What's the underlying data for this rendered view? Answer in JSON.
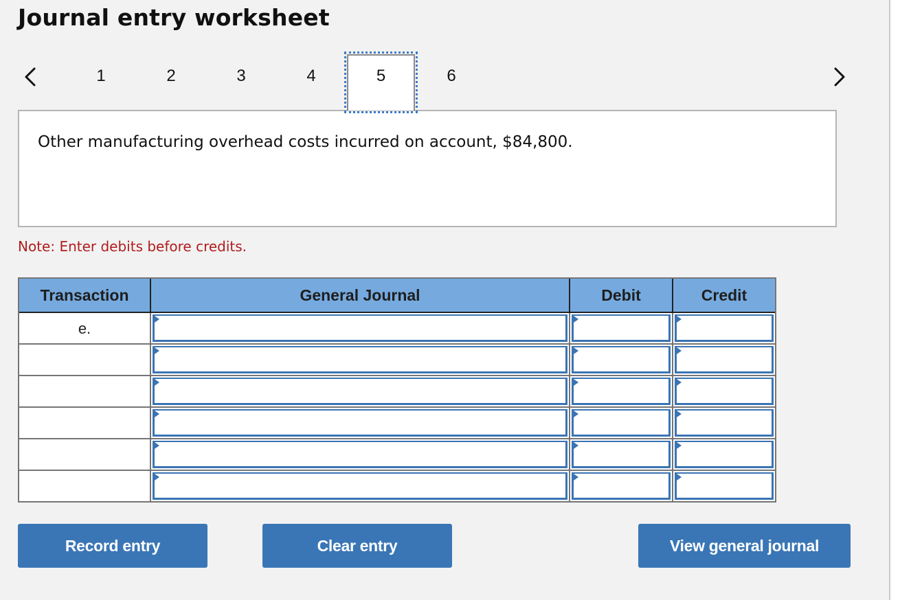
{
  "title": "Journal entry worksheet",
  "navigation": {
    "prev_icon": "chevron-left-icon",
    "next_icon": "chevron-right-icon",
    "steps": [
      "1",
      "2",
      "3",
      "4",
      "5",
      "6"
    ],
    "active_step": "5"
  },
  "description": "Other manufacturing overhead costs incurred on account, $84,800.",
  "note": "Note: Enter debits before credits.",
  "table": {
    "headers": {
      "transaction": "Transaction",
      "general_journal": "General Journal",
      "debit": "Debit",
      "credit": "Credit"
    },
    "rows": [
      {
        "transaction": "e.",
        "general_journal": "",
        "debit": "",
        "credit": ""
      },
      {
        "transaction": "",
        "general_journal": "",
        "debit": "",
        "credit": ""
      },
      {
        "transaction": "",
        "general_journal": "",
        "debit": "",
        "credit": ""
      },
      {
        "transaction": "",
        "general_journal": "",
        "debit": "",
        "credit": ""
      },
      {
        "transaction": "",
        "general_journal": "",
        "debit": "",
        "credit": ""
      },
      {
        "transaction": "",
        "general_journal": "",
        "debit": "",
        "credit": ""
      }
    ]
  },
  "buttons": {
    "record": "Record entry",
    "clear": "Clear entry",
    "view": "View general journal"
  },
  "colors": {
    "header_bg": "#76aadf",
    "button_bg": "#3a76b6",
    "input_border": "#3a74b4",
    "note_text": "#b01c1c",
    "focus_outline": "#3d7cc9"
  }
}
